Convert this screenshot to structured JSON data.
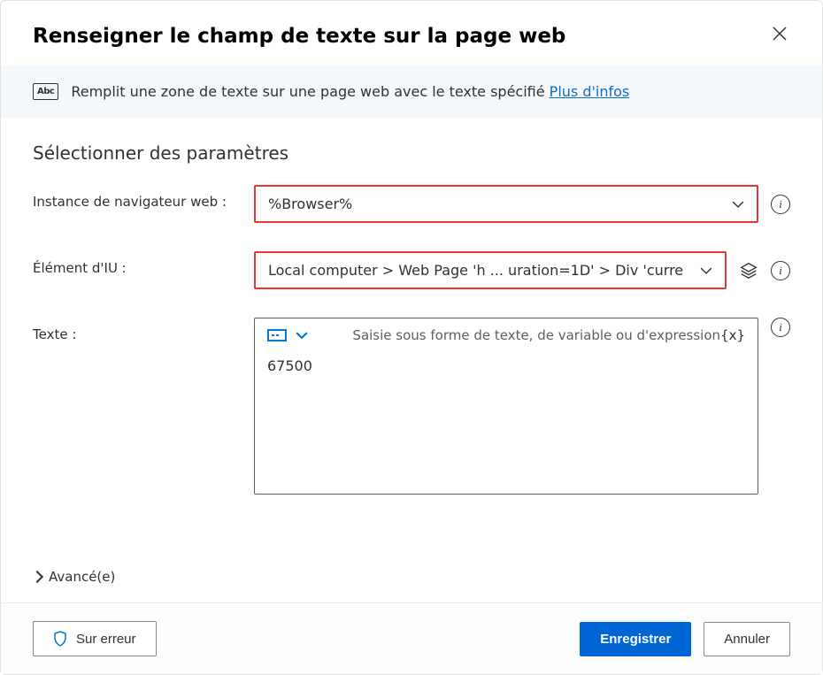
{
  "header": {
    "title": "Renseigner le champ de texte sur la page web"
  },
  "banner": {
    "icon_label": "Abc",
    "text": "Remplit une zone de texte sur une page web avec le texte spécifié",
    "link": "Plus d'infos"
  },
  "section": {
    "title": "Sélectionner des paramètres"
  },
  "rows": {
    "browser": {
      "label": "Instance de navigateur web :",
      "value": "%Browser%"
    },
    "element": {
      "label": "Élément d'IU :",
      "value": "Local computer > Web Page 'h ... uration=1D'  > Div 'curre"
    },
    "text": {
      "label": "Texte :",
      "placeholder": "Saisie sous forme de texte, de variable ou d'expression",
      "var_icon": "{x}",
      "value": "67500"
    }
  },
  "advanced": {
    "label": "Avancé(e)"
  },
  "footer": {
    "on_error": "Sur erreur",
    "save": "Enregistrer",
    "cancel": "Annuler"
  }
}
